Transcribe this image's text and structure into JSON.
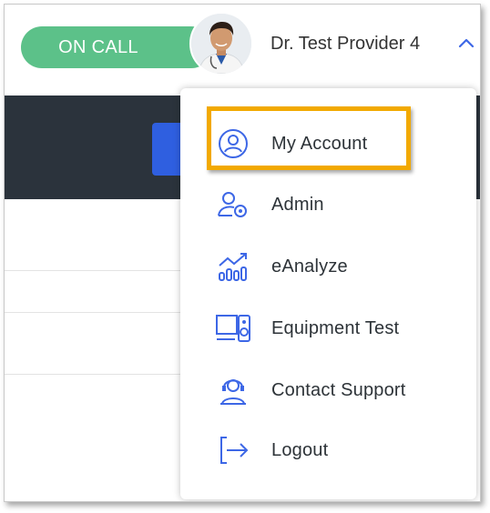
{
  "header": {
    "status_label": "ON CALL",
    "provider_name": "Dr. Test Provider 4",
    "status_color": "#5cc189"
  },
  "menu": {
    "items": [
      {
        "label": "My Account",
        "icon": "user-circle-icon"
      },
      {
        "label": "Admin",
        "icon": "user-gear-icon"
      },
      {
        "label": "eAnalyze",
        "icon": "analytics-icon"
      },
      {
        "label": "Equipment Test",
        "icon": "monitor-speaker-icon"
      },
      {
        "label": "Contact Support",
        "icon": "support-headset-icon"
      },
      {
        "label": "Logout",
        "icon": "logout-icon"
      }
    ],
    "highlight_color": "#f2a900",
    "icon_color": "#3d67e6"
  }
}
